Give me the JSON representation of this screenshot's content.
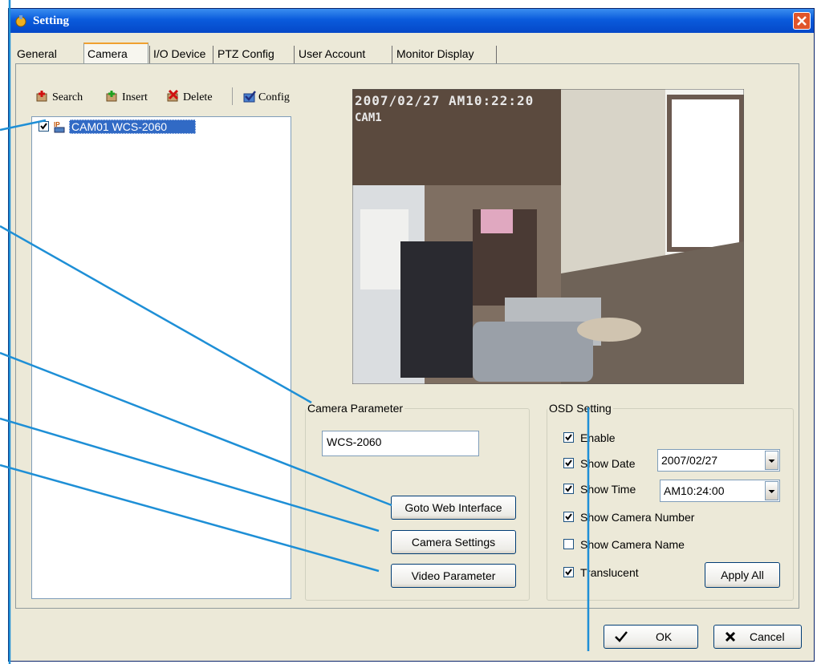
{
  "window": {
    "title": "Setting"
  },
  "tabs": [
    "General",
    "Camera",
    "I/O Device",
    "PTZ Config",
    "User Account",
    "Monitor Display"
  ],
  "toolbar": {
    "search": "Search",
    "insert": "Insert",
    "delete": "Delete",
    "config": "Config"
  },
  "tree": {
    "item_label": "CAM01 WCS-2060",
    "item_checked": true,
    "device_icon": "ip-camera-icon"
  },
  "preview": {
    "osd_datetime": "2007/02/27  AM10:22:20",
    "osd_camera": "CAM1"
  },
  "camera_parameter": {
    "legend": "Camera Parameter",
    "name_value": "WCS-2060",
    "goto_web_label": "Goto Web Interface",
    "camera_settings_label": "Camera Settings",
    "video_parameter_label": "Video Parameter"
  },
  "osd_setting": {
    "legend": "OSD Setting",
    "enable": {
      "label": "Enable",
      "checked": true
    },
    "show_date": {
      "label": "Show Date",
      "checked": true,
      "value": "2007/02/27"
    },
    "show_time": {
      "label": "Show Time",
      "checked": true,
      "value": "AM10:24:00"
    },
    "show_camera_number": {
      "label": "Show Camera Number",
      "checked": true
    },
    "show_camera_name": {
      "label": "Show Camera Name",
      "checked": false
    },
    "translucent": {
      "label": "Translucent",
      "checked": true
    },
    "apply_all_label": "Apply All"
  },
  "footer": {
    "ok_label": "OK",
    "cancel_label": "Cancel"
  },
  "colors": {
    "titlebar": "#0a5bdc",
    "window_bg": "#ece9d8",
    "callout_line": "#1e8fd6",
    "selection": "#316ac5"
  }
}
